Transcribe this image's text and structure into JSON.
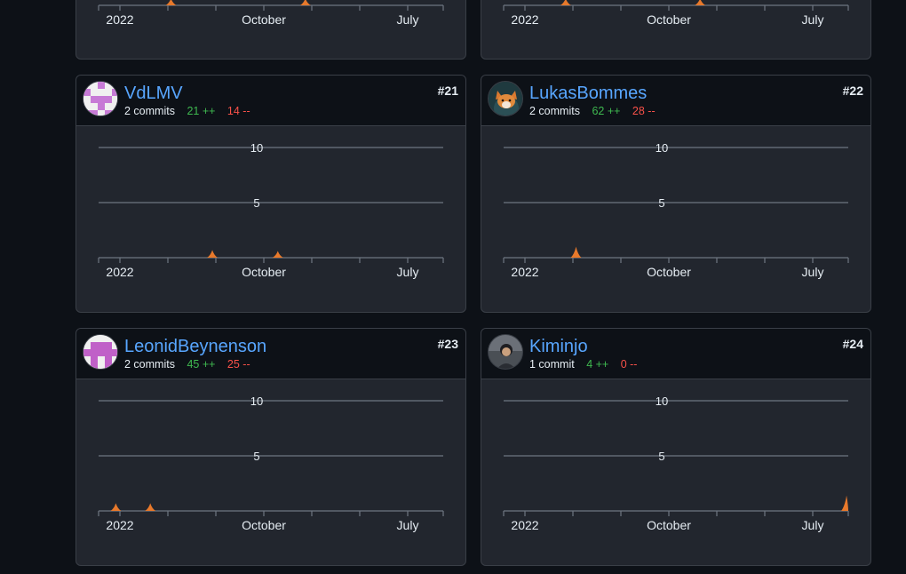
{
  "x_ticks": [
    "2022",
    "October",
    "July"
  ],
  "y_ticks": [
    "10",
    "5"
  ],
  "colors": {
    "accent": "#e8792b",
    "link": "#58a6ff",
    "add": "#3fb950",
    "del": "#f85149"
  },
  "top_cards": [
    {
      "peaks": [
        0.21,
        0.6
      ]
    },
    {
      "peaks": [
        0.18,
        0.57
      ]
    }
  ],
  "contributors": [
    {
      "username": "VdLMV",
      "commits_label": "2 commits",
      "additions": "21 ++",
      "deletions": "14 --",
      "rank": "#21",
      "avatar_icon": "identicon-icon",
      "chart_data": {
        "type": "area",
        "ylim": [
          0,
          10
        ],
        "y_ticks": [
          5,
          10
        ],
        "x_ticks": [
          "2022",
          "October",
          "July"
        ],
        "peaks": [
          {
            "x": 0.33,
            "y": 0.7
          },
          {
            "x": 0.52,
            "y": 0.6
          }
        ]
      }
    },
    {
      "username": "LukasBommes",
      "commits_label": "2 commits",
      "additions": "62 ++",
      "deletions": "28 --",
      "rank": "#22",
      "avatar_icon": "fox-avatar-icon",
      "chart_data": {
        "type": "area",
        "ylim": [
          0,
          10
        ],
        "y_ticks": [
          5,
          10
        ],
        "x_ticks": [
          "2022",
          "October",
          "July"
        ],
        "peaks": [
          {
            "x": 0.21,
            "y": 1.0
          }
        ]
      }
    },
    {
      "username": "LeonidBeynenson",
      "commits_label": "2 commits",
      "additions": "45 ++",
      "deletions": "25 --",
      "rank": "#23",
      "avatar_icon": "identicon-icon",
      "chart_data": {
        "type": "area",
        "ylim": [
          0,
          10
        ],
        "y_ticks": [
          5,
          10
        ],
        "x_ticks": [
          "2022",
          "October",
          "July"
        ],
        "peaks": [
          {
            "x": 0.05,
            "y": 0.7
          },
          {
            "x": 0.15,
            "y": 0.7
          }
        ]
      }
    },
    {
      "username": "Kiminjo",
      "commits_label": "1 commit",
      "additions": "4 ++",
      "deletions": "0 --",
      "rank": "#24",
      "avatar_icon": "photo-avatar-icon",
      "chart_data": {
        "type": "area",
        "ylim": [
          0,
          10
        ],
        "y_ticks": [
          5,
          10
        ],
        "x_ticks": [
          "2022",
          "October",
          "July"
        ],
        "peaks": [
          {
            "x": 0.995,
            "y": 1.4
          }
        ]
      }
    }
  ]
}
